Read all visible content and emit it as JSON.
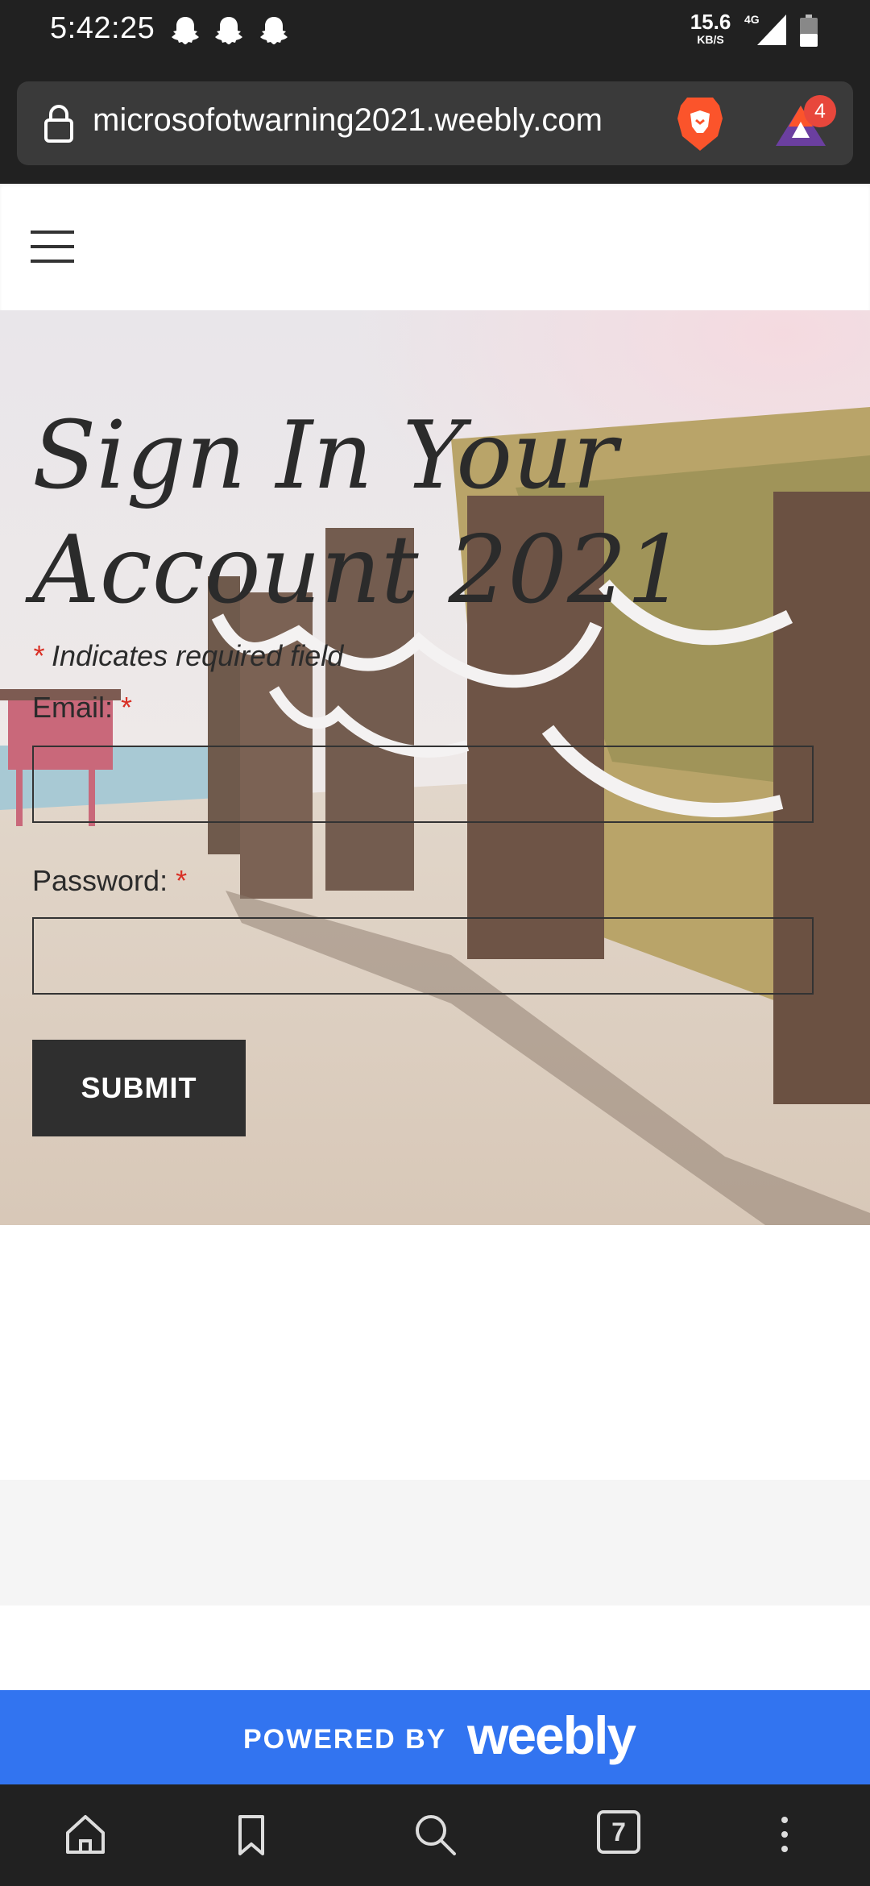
{
  "status_bar": {
    "time": "5:42:25",
    "notification_icons": [
      "snapchat-icon",
      "snapchat-icon",
      "snapchat-icon"
    ],
    "net_speed_value": "15.6",
    "net_speed_unit": "KB/S",
    "network_type": "4G",
    "icons": [
      "signal-icon",
      "battery-icon"
    ]
  },
  "browser": {
    "url": "microsofotwarning2021.weebly.com",
    "rewards_badge": "4",
    "icons": [
      "lock-icon",
      "brave-shields-icon",
      "brave-rewards-icon"
    ]
  },
  "site_header": {
    "menu_icon": "hamburger-menu-icon"
  },
  "form": {
    "title": "Sign In Your Account 2021",
    "required_asterisk": "*",
    "required_note": "Indicates required field",
    "email_label": "Email:",
    "email_value": "",
    "password_label": "Password:",
    "password_value": "",
    "submit_label": "SUBMIT"
  },
  "footer": {
    "powered_by": "POWERED BY",
    "brand": "weebly"
  },
  "bottom_nav": {
    "tab_count": "7",
    "icons": [
      "home-icon",
      "bookmark-icon",
      "search-icon",
      "tabs-icon",
      "more-options-icon"
    ]
  },
  "colors": {
    "status_bar_bg": "#212121",
    "url_bar_bg": "#3a3a3a",
    "submit_bg": "#2f2f2f",
    "required_asterisk": "#d93025",
    "powered_bar_bg": "#3274f0",
    "rewards_badge_bg": "#e8473c"
  }
}
